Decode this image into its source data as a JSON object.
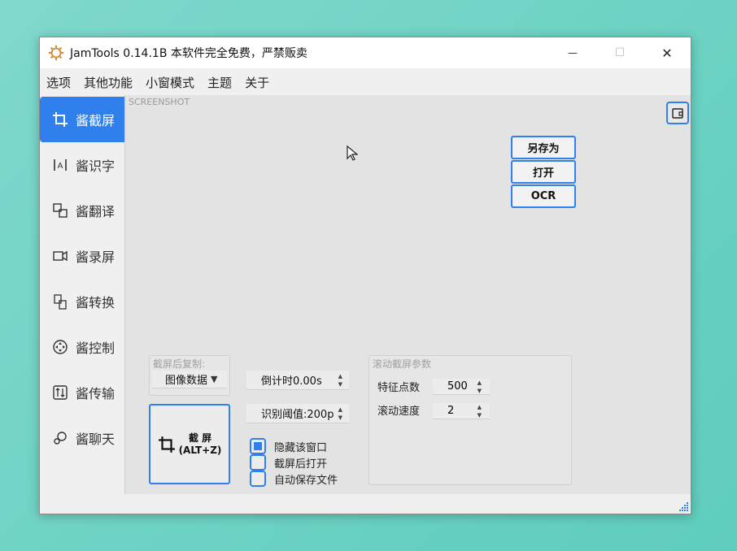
{
  "window": {
    "title": "JamTools 0.14.1B 本软件完全免费，严禁贩卖",
    "controls": {
      "minimize": "—",
      "maximize": "☐",
      "close": "✕"
    }
  },
  "menubar": {
    "items": [
      "选项",
      "其他功能",
      "小窗模式",
      "主题",
      "关于"
    ]
  },
  "sidebar": {
    "items": [
      {
        "label": "酱截屏",
        "icon": "crop-icon",
        "active": true
      },
      {
        "label": "酱识字",
        "icon": "ocr-icon"
      },
      {
        "label": "酱翻译",
        "icon": "translate-icon"
      },
      {
        "label": "酱录屏",
        "icon": "video-icon"
      },
      {
        "label": "酱转换",
        "icon": "convert-icon"
      },
      {
        "label": "酱控制",
        "icon": "control-icon"
      },
      {
        "label": "酱传输",
        "icon": "transfer-icon"
      },
      {
        "label": "酱聊天",
        "icon": "chat-icon"
      }
    ]
  },
  "main": {
    "section_label": "SCREENSHOT",
    "actions": {
      "save_as": "另存为",
      "open": "打开",
      "ocr": "OCR"
    },
    "copy_group": {
      "title": "截屏后复制:",
      "selected": "图像数据"
    },
    "capture": {
      "label": "截 屏",
      "shortcut": "(ALT+Z)"
    },
    "countdown": {
      "value": "倒计时0.00s"
    },
    "threshold": {
      "value": "识别阈值:200p"
    },
    "options": {
      "hide_window": {
        "label": "隐藏该窗口",
        "checked": true
      },
      "open_after": {
        "label": "截屏后打开",
        "checked": false
      },
      "auto_save": {
        "label": "自动保存文件",
        "checked": false
      }
    },
    "scroll_params": {
      "title": "滚动截屏参数",
      "feature_points": {
        "label": "特征点数",
        "value": "500"
      },
      "scroll_speed": {
        "label": "滚动速度",
        "value": "2"
      }
    }
  },
  "colors": {
    "accent": "#2f80ed",
    "panel": "#e3e3e3",
    "desktop": "#6ed3c4"
  }
}
